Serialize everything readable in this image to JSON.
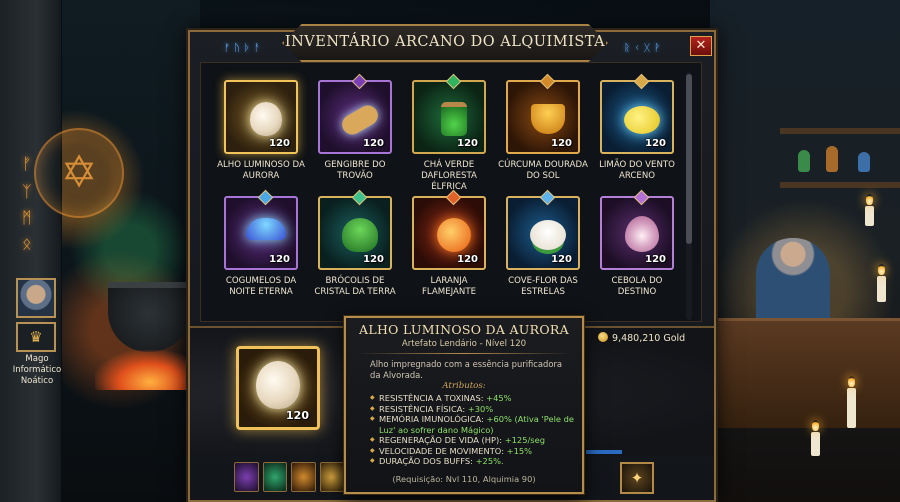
{
  "window": {
    "title": "INVENTÁRIO ARCANO DO ALQUIMISTA",
    "close_label": "✕",
    "runes_left": "ᚠᚢᚦᚨ",
    "runes_right": "ᚱᚲᚷᚹ"
  },
  "items": [
    {
      "name": "Alho Luminoso da Aurora",
      "qty": "120",
      "icon": "garlic-icon",
      "frame": "gold",
      "selected": true
    },
    {
      "name": "Gengibre do Trovão",
      "qty": "120",
      "icon": "ginger-icon",
      "frame": "purple"
    },
    {
      "name": "Chá Verde Dafloresta Élfrica",
      "qty": "120",
      "icon": "jar-icon",
      "frame": "green"
    },
    {
      "name": "Cúrcuma Dourada do Sol",
      "qty": "120",
      "icon": "bowl-icon",
      "frame": "orange"
    },
    {
      "name": "Limão do Vento Arceno",
      "qty": "120",
      "icon": "lemon-icon",
      "frame": "blue"
    },
    {
      "name": "Cogumelos da Noite Eterna",
      "qty": "120",
      "icon": "mushroom-icon",
      "frame": "purple"
    },
    {
      "name": "Brócolis de Cristal da Terra",
      "qty": "120",
      "icon": "broccoli-icon",
      "frame": "teal"
    },
    {
      "name": "Laranja Flamejante",
      "qty": "120",
      "icon": "orange-fruit-icon",
      "frame": "red"
    },
    {
      "name": "Cove-Flor das Estrelas",
      "qty": "120",
      "icon": "cauliflower-icon",
      "frame": "blue"
    },
    {
      "name": "Cebola do Destino",
      "qty": "120",
      "icon": "onion-icon",
      "frame": "violet"
    }
  ],
  "character": {
    "label": "Mago Informático Noático"
  },
  "selected": {
    "qty": "120"
  },
  "gold": {
    "amount": "9,480,210 Gold"
  },
  "tooltip": {
    "title": "ALHO LUMINOSO DA AURORA",
    "subtitle": "Artefato Lendário - Nível 120",
    "description": "Alho impregnado com a essência purificadora da Alvorada.",
    "attributes_header": "Atributos:",
    "attributes": [
      {
        "label": "RESISTÊNCIA A TOXINAS:",
        "value": "+45%"
      },
      {
        "label": "RESISTÊNCIA FÍSICA:",
        "value": "+30%"
      },
      {
        "label": "MEMÓRIA IMUNOLÓGICA:",
        "value": "+60% (Ativa 'Pele de Luz' ao sofrer dano Mágico)"
      },
      {
        "label": "REGENERAÇÃO DE VIDA (HP):",
        "value": "+125/seg"
      },
      {
        "label": "VELOCIDADE DE MOVIMENTO:",
        "value": "+15%"
      },
      {
        "label": "DURAÇÃO DOS BUFFS:",
        "value": "+25%."
      }
    ],
    "requirement": "(Requisição: Nvl 110, Alquimia 90)"
  },
  "colors": {
    "frame_gold": "#d8b25c",
    "stat_green": "#8fe06a",
    "close_red": "#b3221c",
    "rune_blue": "#6fb6ff"
  }
}
